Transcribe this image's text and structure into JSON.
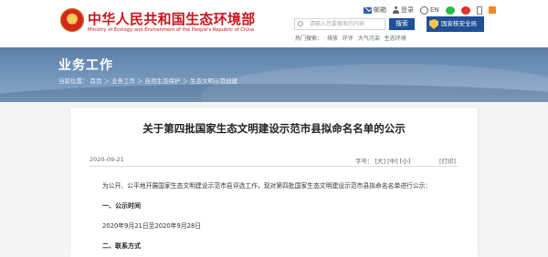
{
  "site": {
    "name_cn": "中华人民共和国生态环境部",
    "name_en": "Ministry of Ecology and Environment of the People's Republic of China"
  },
  "top_links": [
    {
      "icon": "mail-icon",
      "label": "邮箱"
    },
    {
      "icon": "person-icon",
      "label": "登录"
    },
    {
      "icon": "globe-icon",
      "label": "EN"
    },
    {
      "icon": "wechat-icon",
      "label": ""
    },
    {
      "icon": "weibo-icon",
      "label": ""
    },
    {
      "icon": "phone-icon",
      "label": ""
    },
    {
      "icon": "feed-icon",
      "label": ""
    }
  ],
  "search": {
    "placeholder": "请输入您要搜索的内容",
    "button": "搜索",
    "hot_label": "热门搜索：",
    "hot_words": [
      "排放",
      "环评",
      "大气污染",
      "生态环境"
    ]
  },
  "badge": {
    "text": "国家核安全局"
  },
  "banner": {
    "title": "业务工作",
    "breadcrumb": [
      "当前位置：",
      "首页",
      "＞",
      "业务工作",
      "＞",
      "自然生态保护",
      "＞",
      "生态文明示范创建"
    ]
  },
  "article": {
    "title": "关于第四批国家生态文明建设示范市县拟命名名单的公示",
    "date": "2020-09-21",
    "font_label": "字号：",
    "font_sizes": [
      "[大]",
      "[中]",
      "[小]"
    ],
    "print": "[打印]",
    "intro": "为公开、公平地开展国家生态文明建设示范市县评选工作，现对第四批国家生态文明建设示范市县拟命名名单进行公示：",
    "section1_title": "一、公示时间",
    "section1_body": "2020年9月21日至2020年9月28日",
    "section2_title": "二、联系方式"
  },
  "colors": {
    "brand_red": "#c8161d",
    "nav_blue": "#1f4f97",
    "banner_blue": "#6f92b8"
  }
}
